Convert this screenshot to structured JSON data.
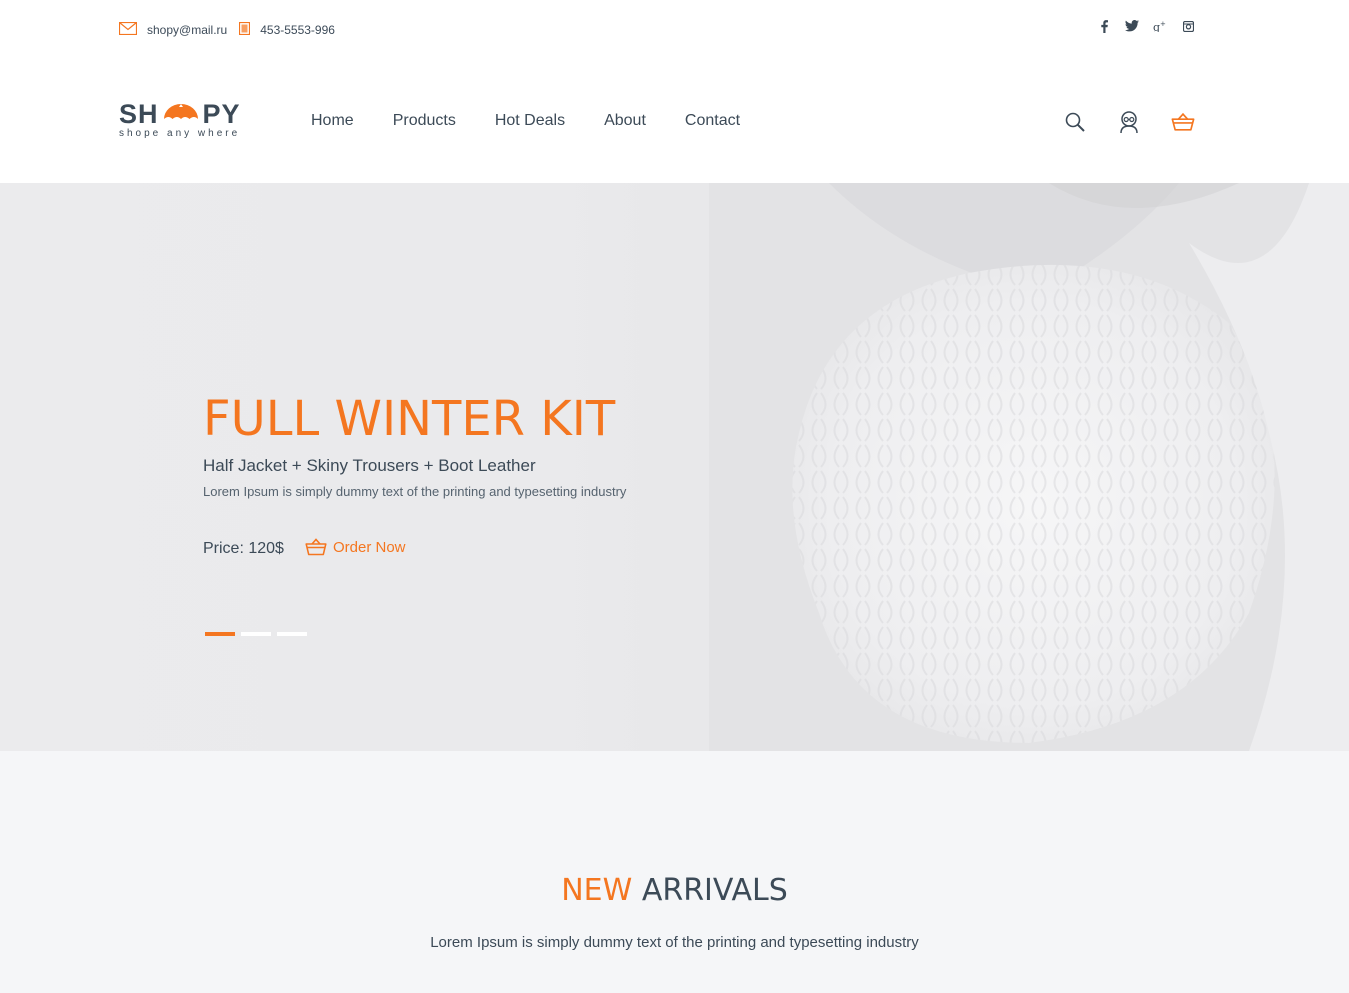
{
  "topbar": {
    "email": "shopy@mail.ru",
    "phone": "453-5553-996",
    "social": [
      "facebook-icon",
      "twitter-icon",
      "google-plus-icon",
      "instagram-icon"
    ]
  },
  "header": {
    "logo_left": "SH",
    "logo_right": "PY",
    "logo_tagline": "shope any where",
    "nav": [
      "Home",
      "Products",
      "Hot Deals",
      "About",
      "Contact"
    ],
    "tools": [
      "search-icon",
      "user-icon",
      "basket-icon"
    ]
  },
  "hero": {
    "title": "FULL WINTER KIT",
    "subtitle": "Half Jacket + Skiny Trousers + Boot Leather",
    "description": "Lorem Ipsum is simply dummy text of the printing and typesetting industry",
    "price": "Price: 120$",
    "order_label": "Order Now",
    "slides_total": 3,
    "slide_active": 1
  },
  "arrivals": {
    "title_accent": "NEW",
    "title_rest": "ARRIVALS",
    "description": "Lorem Ipsum is simply dummy text of the printing and typesetting industry"
  },
  "colors": {
    "accent": "#f47620",
    "text": "#3c4a57",
    "section_bg": "#f5f6f8"
  }
}
